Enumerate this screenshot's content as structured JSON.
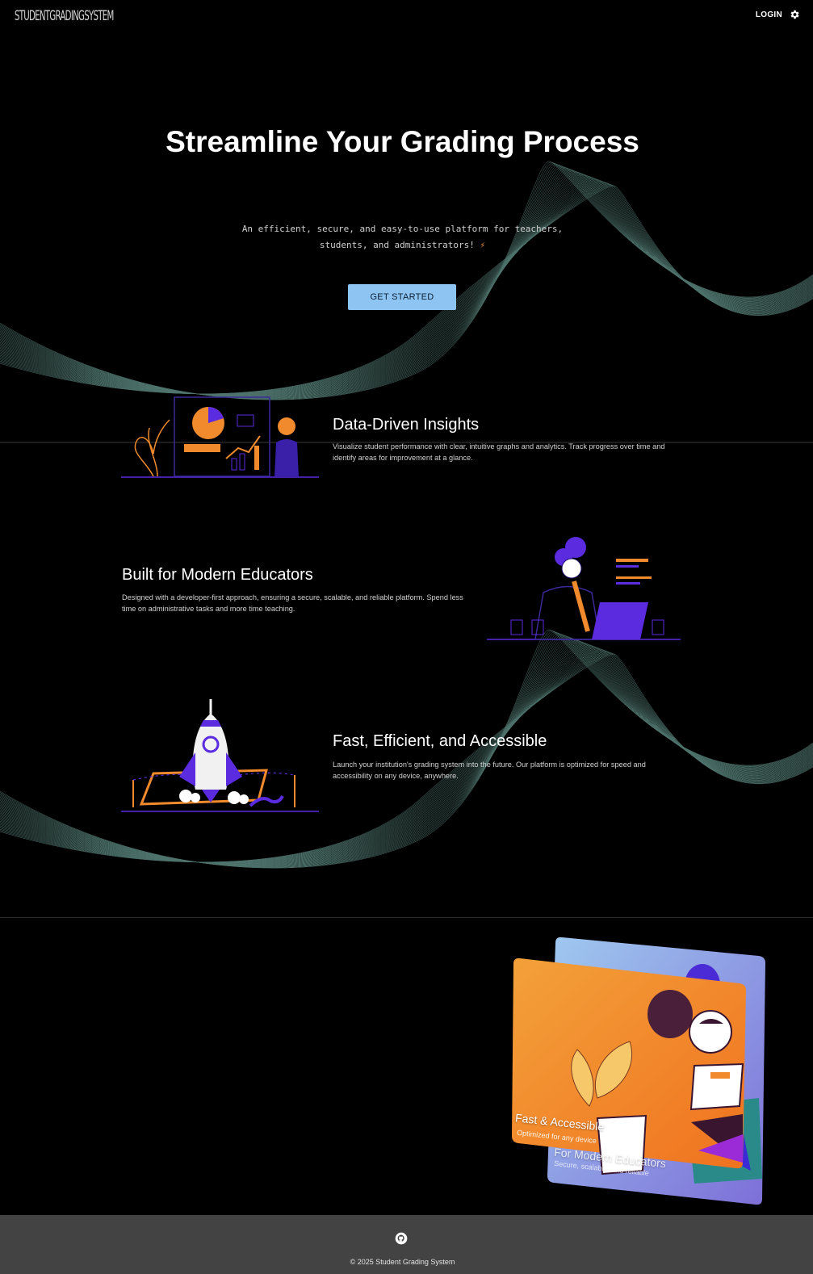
{
  "header": {
    "brand": "STUDENTGRADINGSYSTEM",
    "login_label": "LOGIN"
  },
  "hero": {
    "title": "Streamline Your Grading Process",
    "subtitle_line1": "An efficient, secure, and easy-to-use platform for teachers,",
    "subtitle_line2": "students, and administrators!",
    "cta_label": "GET STARTED"
  },
  "features": [
    {
      "title": "Data-Driven Insights",
      "text": "Visualize student performance with clear, intuitive graphs and analytics. Track progress over time and identify areas for improvement at a glance."
    },
    {
      "title": "Built for Modern Educators",
      "text": "Designed with a developer-first approach, ensuring a secure, scalable, and reliable platform. Spend less time on administrative tasks and more time teaching."
    },
    {
      "title": "Fast, Efficient, and Accessible",
      "text": "Launch your institution's grading system into the future. Our platform is optimized for speed and accessibility on any device, anywhere."
    }
  ],
  "cards": {
    "front_title": "Fast & Accessible",
    "front_subtitle": "Optimized for any device",
    "back_title": "For Modern Educators",
    "back_subtitle": "Secure, scalable, and reliable"
  },
  "footer": {
    "copyright": "© 2025 Student Grading System"
  },
  "colors": {
    "background": "#000000",
    "cta": "#8ec4f2",
    "accent_orange": "#f08a2c",
    "accent_purple": "#5b2be0",
    "wave": "#8fd3c6",
    "footer": "#434343"
  }
}
